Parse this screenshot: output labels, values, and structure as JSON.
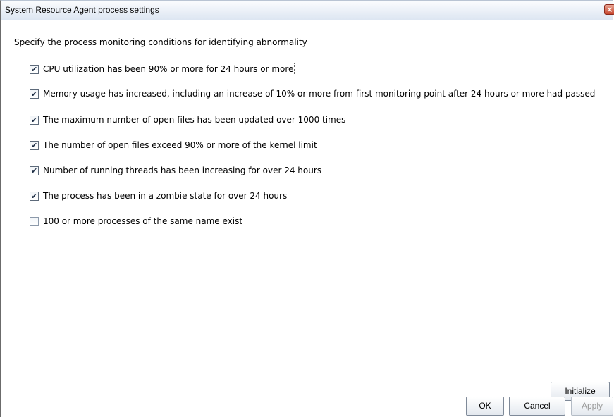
{
  "window": {
    "title": "System Resource Agent process settings",
    "close_glyph": "×"
  },
  "description": "Specify the process monitoring conditions for identifying abnormality",
  "options": [
    {
      "label": "CPU utilization has been 90% or more for 24 hours or more",
      "checked": true
    },
    {
      "label": "Memory usage has increased, including an increase of 10% or more from first monitoring point after 24 hours or more had passed",
      "checked": true
    },
    {
      "label": "The maximum number of open files has been updated over 1000 times",
      "checked": true
    },
    {
      "label": "The number of open files exceed 90% or more of the kernel limit",
      "checked": true
    },
    {
      "label": "Number of running threads has been increasing for over 24 hours",
      "checked": true
    },
    {
      "label": "The process has been in a zombie state for over 24 hours",
      "checked": true
    },
    {
      "label": "100 or more processes of the same name exist",
      "checked": false
    }
  ],
  "buttons": {
    "initialize": "Initialize",
    "ok": "OK",
    "cancel": "Cancel",
    "apply": "Apply"
  },
  "icons": {
    "check": "✔",
    "close": "close-icon"
  }
}
